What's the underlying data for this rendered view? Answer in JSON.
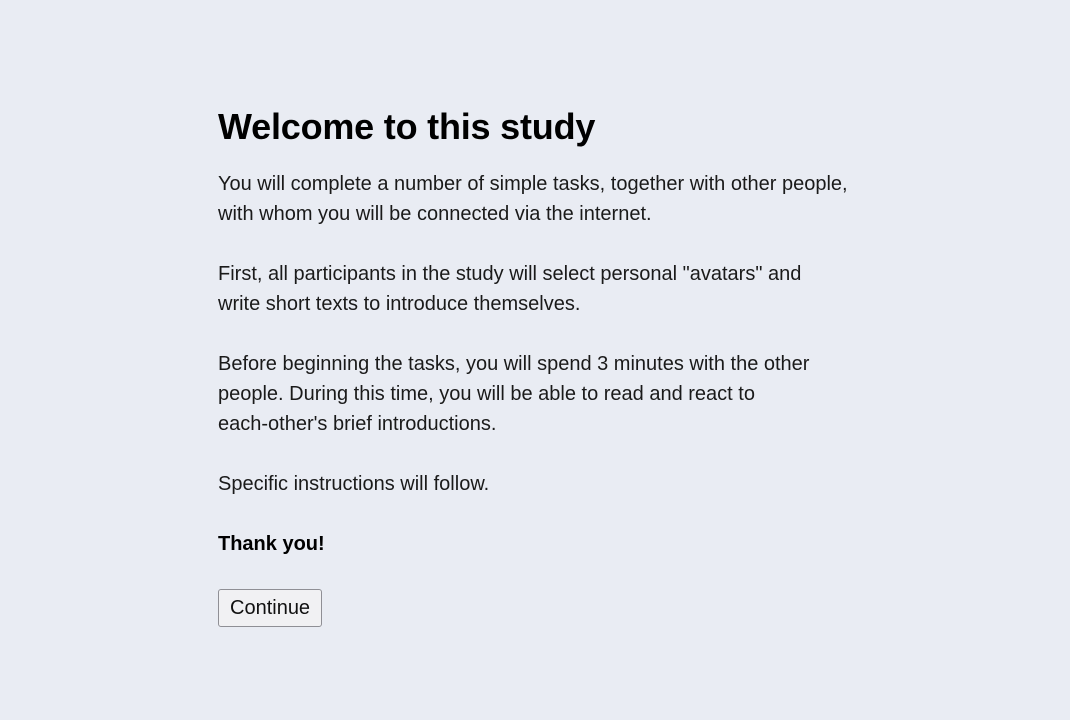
{
  "page": {
    "title": "Welcome to this study",
    "paragraphs": [
      "You will complete a number of simple tasks, together with other people,\nwith whom you will be connected via the internet.",
      "First, all participants in the study will select personal \"avatars\" and\nwrite short texts to introduce themselves.",
      "Before beginning the tasks, you will spend 3 minutes with the other\npeople. During this time, you will be able to read and react to\neach-other's brief introductions.",
      "Specific instructions will follow."
    ],
    "thanks": "Thank you!",
    "continue_label": "Continue"
  },
  "colors": {
    "background": "#e9ecf3",
    "text": "#1a1a1a"
  }
}
